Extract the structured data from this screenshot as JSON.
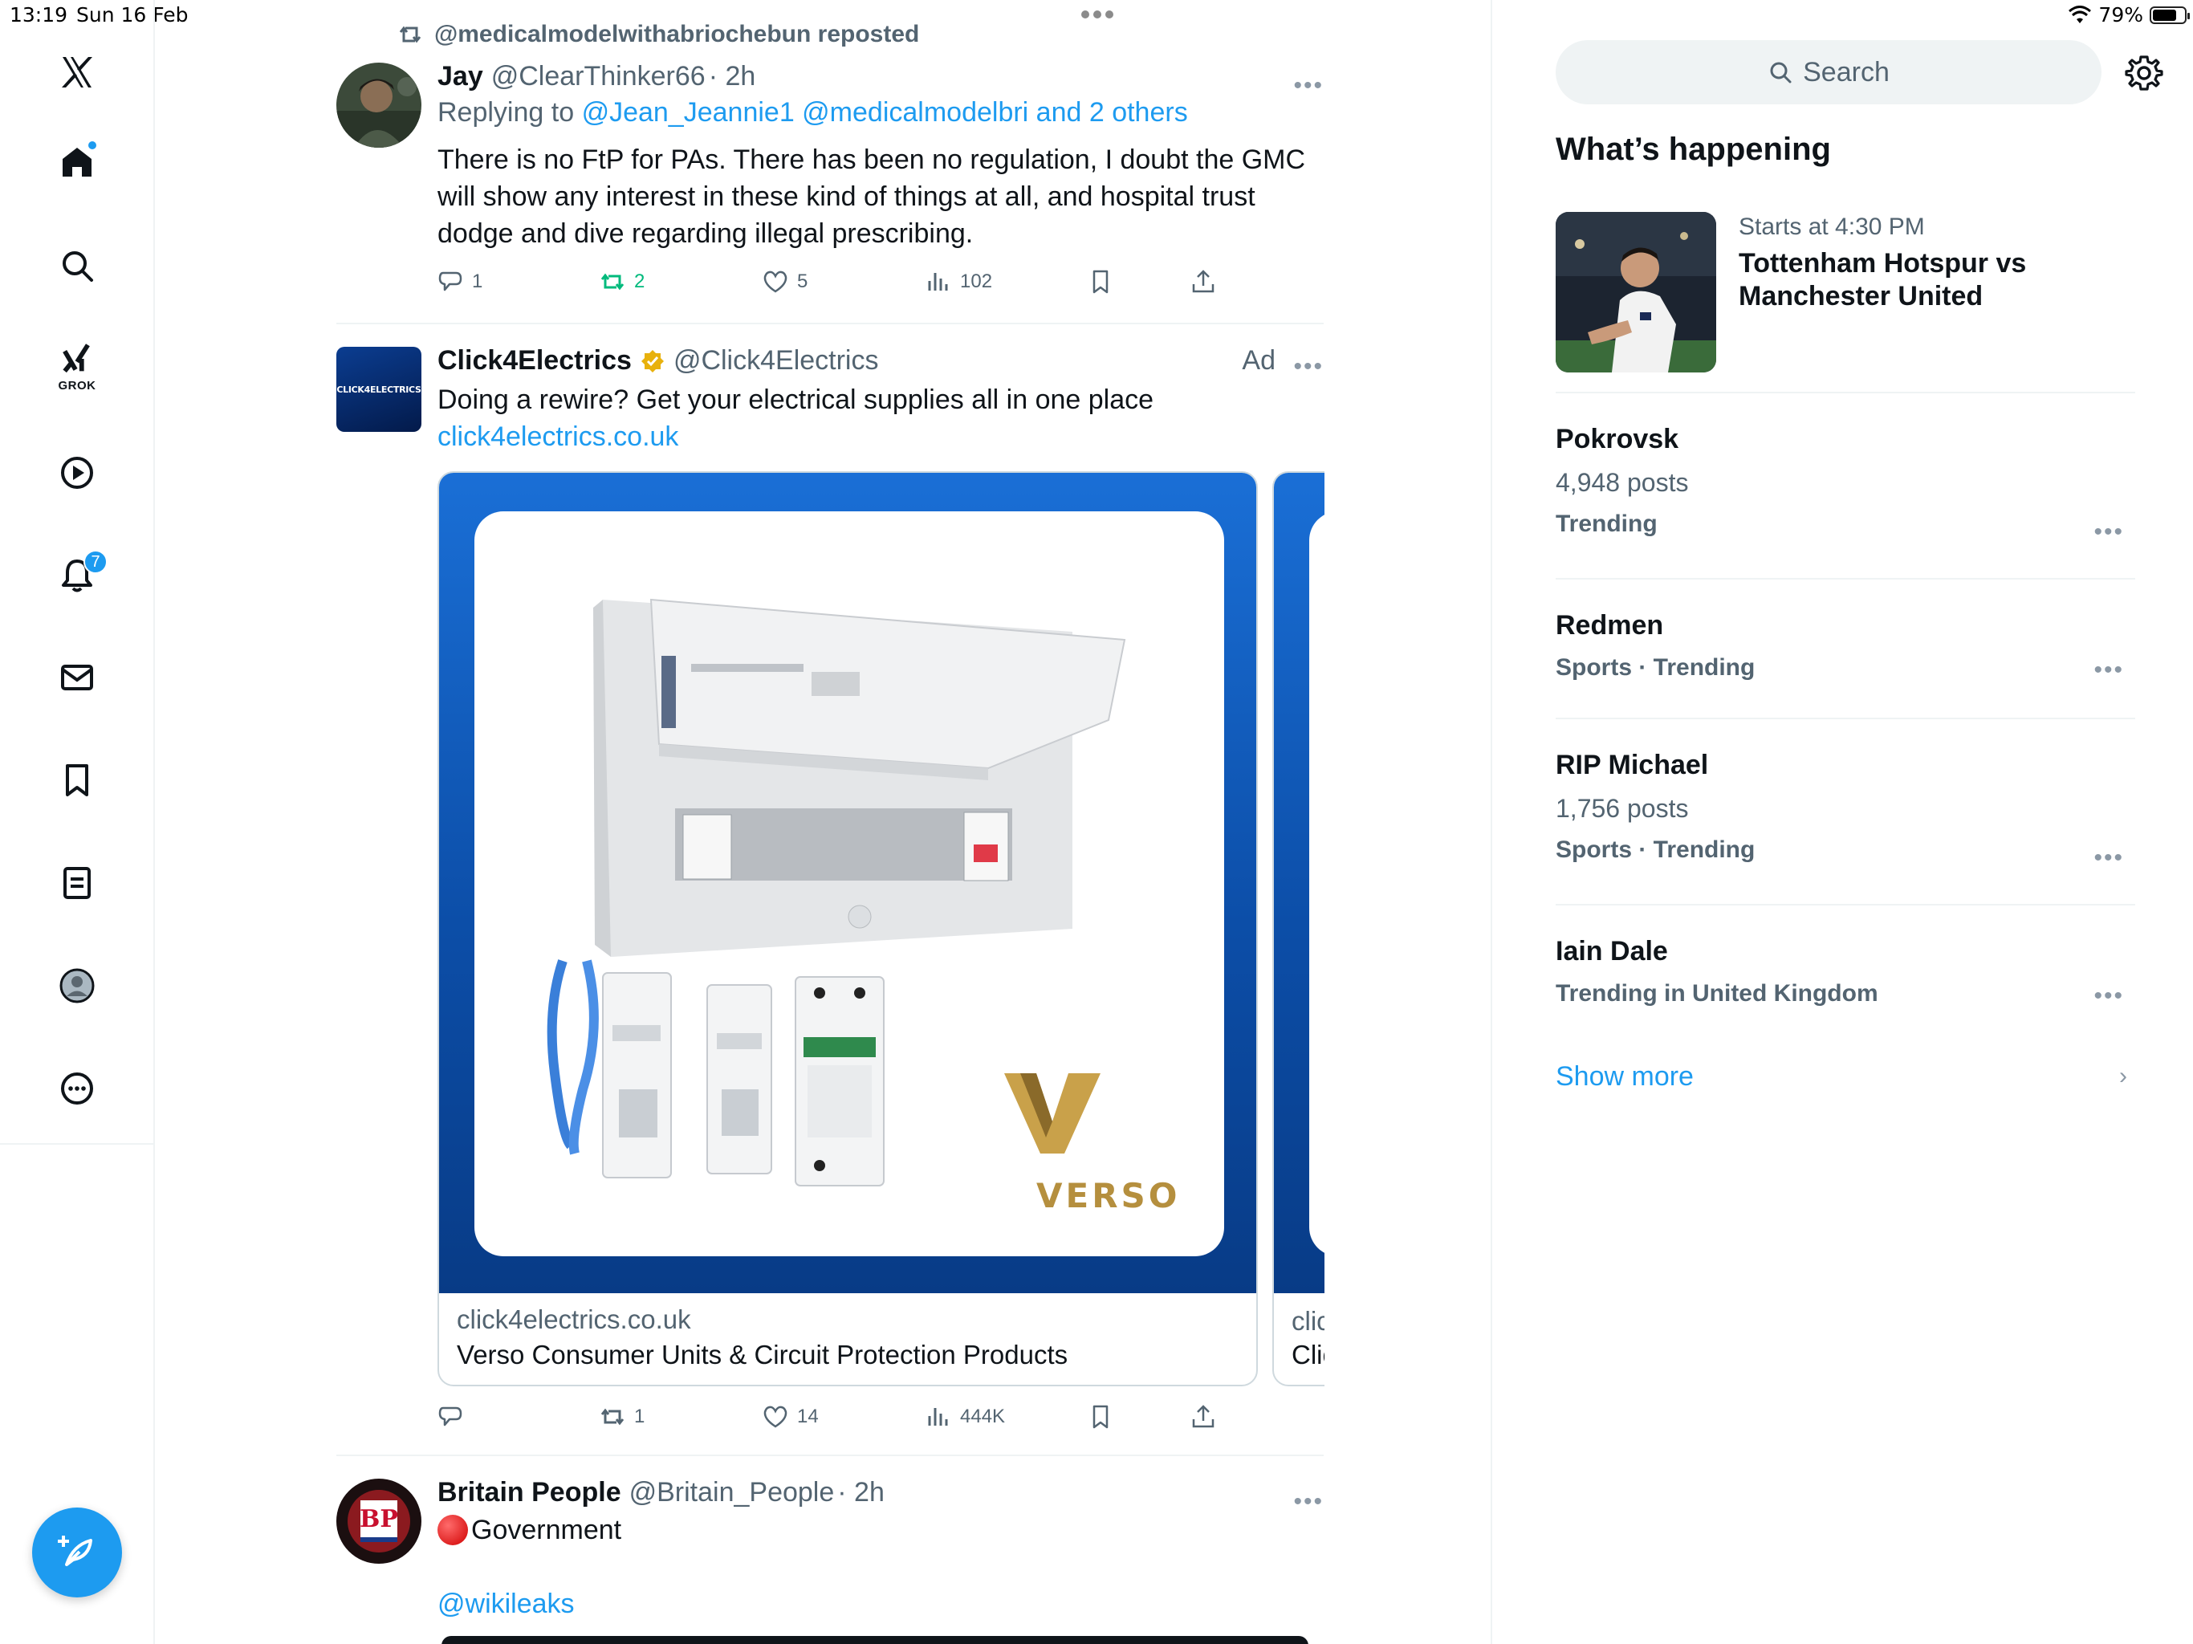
{
  "status_bar": {
    "time": "13:19",
    "date": "Sun 16 Feb",
    "battery": "79%"
  },
  "nav": {
    "items": [
      {
        "name": "home",
        "badge": ""
      },
      {
        "name": "explore"
      },
      {
        "name": "grok",
        "label": "GROK"
      },
      {
        "name": "video"
      },
      {
        "name": "notifications",
        "badge": "7"
      },
      {
        "name": "messages"
      },
      {
        "name": "bookmarks"
      },
      {
        "name": "lists"
      },
      {
        "name": "profile"
      },
      {
        "name": "more"
      }
    ]
  },
  "feed": {
    "repost_banner": "@medicalmodelwithabriochebun reposted",
    "tweet1": {
      "name": "Jay",
      "handle": "@ClearThinker66",
      "time": "· 2h",
      "replying_prefix": "Replying to",
      "replying_to": "@Jean_Jeannie1 @medicalmodelbri and 2 others",
      "text": "There is no FtP for PAs. There has been no regulation, I doubt the GMC will show any interest in these kind of things at all, and hospital trust dodge and dive regarding illegal prescribing.",
      "replies": "1",
      "reposts": "2",
      "likes": "5",
      "views": "102"
    },
    "ad": {
      "name": "Click4Electrics",
      "handle": "@Click4Electrics",
      "ad_label": "Ad",
      "avatar_text": "CLICK4ELECTRICS",
      "text": "Doing a rewire? Get your electrical supplies all in one place",
      "link": "click4electrics.co.uk",
      "card_domain": "click4electrics.co.uk",
      "card_title": "Verso Consumer Units & Circuit Protection Products",
      "peek_domain": "clic",
      "peek_title": "Clic",
      "brand_logo": "VERSO",
      "replies": "",
      "reposts": "1",
      "likes": "14",
      "views": "444K"
    },
    "tweet3": {
      "name": "Britain People",
      "handle": "@Britain_People",
      "time": "· 2h",
      "avatar_text": "BP",
      "text": "Government",
      "link": "@wikileaks"
    }
  },
  "sidebar": {
    "search_placeholder": "Search",
    "heading": "What’s happening",
    "event": {
      "sub": "Starts at 4:30 PM",
      "title": "Tottenham Hotspur vs Manchester United"
    },
    "trends": [
      {
        "name": "Pokrovsk",
        "posts": "4,948 posts",
        "category": "Trending"
      },
      {
        "name": "Redmen",
        "posts": "",
        "category": "Sports · Trending"
      },
      {
        "name": "RIP Michael",
        "posts": "1,756 posts",
        "category": "Sports · Trending"
      },
      {
        "name": "Iain Dale",
        "posts": "",
        "category": "Trending in United Kingdom"
      }
    ],
    "show_more": "Show more"
  },
  "colors": {
    "accent": "#1d9bf0",
    "repost_green": "#00ba7c",
    "muted": "#536471"
  }
}
